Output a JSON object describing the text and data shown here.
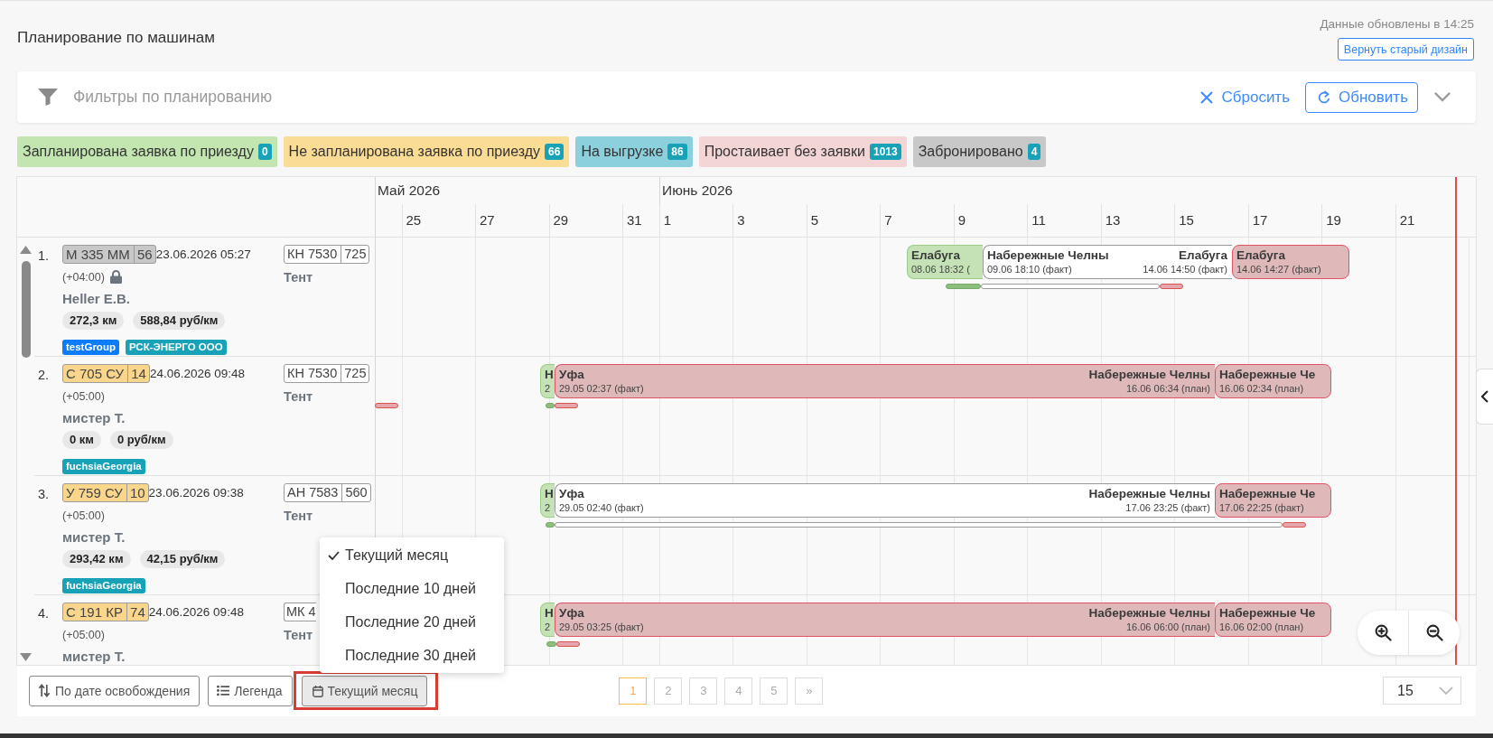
{
  "header": {
    "title": "Планирование по машинам",
    "updated_text": "Данные обновлены в 14:25",
    "old_design_button": "Вернуть старый дизайн"
  },
  "filters": {
    "title": "Фильтры по планированию",
    "reset": "Сбросить",
    "refresh": "Обновить",
    "expanded": false
  },
  "status_chips": [
    {
      "label": "Запланирована заявка по приезду",
      "count": "0",
      "color": "#c3e6b1"
    },
    {
      "label": "Не запланирована заявка по приезду",
      "count": "66",
      "color": "#fbdc95"
    },
    {
      "label": "На выгрузке",
      "count": "86",
      "color": "#8dd0dd"
    },
    {
      "label": "Простаивает без заявки",
      "count": "1013",
      "color": "#f3d5d6"
    },
    {
      "label": "Забронировано",
      "count": "4",
      "color": "#c8c8c8"
    }
  ],
  "timeline": {
    "months": [
      "Май 2026",
      "Июнь 2026"
    ],
    "days": [
      "25",
      "27",
      "29",
      "31",
      "1",
      "3",
      "5",
      "7",
      "9",
      "11",
      "13",
      "15",
      "17",
      "19",
      "21"
    ]
  },
  "vehicles": [
    {
      "number": "1.",
      "plate": {
        "number": "М 335 ММ",
        "region": "56",
        "color": "#c8c8c8"
      },
      "date": "23.06.2026 05:27",
      "timezone": "(+04:00)",
      "locked": true,
      "driver": "Heller E.B.",
      "distance": "272,3 км",
      "rate": "588,84 руб/км",
      "tags": [
        {
          "label": "testGroup",
          "color": "#0b7dfc"
        },
        {
          "label": "РСК-ЭНЕРГО ООО",
          "color": "#17a2b8"
        }
      ],
      "trailer": {
        "number": "КН 7530",
        "region": "725"
      },
      "body": "Тент",
      "trips": [
        {
          "start_label": "Елабуга",
          "start_time": "08.06 18:32 (",
          "color": "#c4e2b5"
        },
        {
          "start_label": "Набережные Челны",
          "start_time": "09.06 18:10 (факт)",
          "end_label": "Елабуга",
          "end_time": "14.06 14:50 (факт)",
          "color": "#ffffff"
        },
        {
          "start_label": "Елабуга",
          "start_time": "14.06 14:27 (факт)",
          "color": "#dfb9ba"
        }
      ],
      "tracks": [
        {
          "color": "#8cbf7c"
        },
        {
          "color": "#ffffff"
        },
        {
          "color": "#e6a6ad"
        }
      ]
    },
    {
      "number": "2.",
      "plate": {
        "number": "С 705 СУ",
        "region": "14",
        "color": "#fad68c"
      },
      "date": "24.06.2026 09:48",
      "timezone": "(+05:00)",
      "locked": false,
      "driver": "мистер Т.",
      "distance": "0 км",
      "rate": "0 руб/км",
      "tags": [
        {
          "label": "fuchsiaGeorgia",
          "color": "#17a2b8"
        }
      ],
      "trailer": {
        "number": "КН 7530",
        "region": "725"
      },
      "body": "Тент",
      "trips": [
        {
          "start_label": "Н",
          "start_time": "2",
          "color": "#c4e2b5"
        },
        {
          "start_label": "Уфа",
          "start_time": "29.05 02:37 (факт)",
          "end_label": "Набережные Челны",
          "end_time": "16.06 06:34 (план)",
          "color": "#dfb9ba"
        },
        {
          "start_label": "Набережные Че",
          "start_time": "16.06 02:34 (план)",
          "color": "#dfb9ba"
        }
      ],
      "tracks": [
        {
          "color": "#e6a6ad"
        },
        {
          "color": "#8cbf7c"
        },
        {
          "color": "#e6a6ad"
        }
      ]
    },
    {
      "number": "3.",
      "plate": {
        "number": "У 759 СУ",
        "region": "10",
        "color": "#fad68c"
      },
      "date": "23.06.2026 09:38",
      "timezone": "(+05:00)",
      "locked": false,
      "driver": "мистер Т.",
      "distance": "293,42 км",
      "rate": "42,15 руб/км",
      "tags": [
        {
          "label": "fuchsiaGeorgia",
          "color": "#17a2b8"
        }
      ],
      "trailer": {
        "number": "АН 7583",
        "region": "560"
      },
      "body": "Тент",
      "trips": [
        {
          "start_label": "Н",
          "start_time": "2",
          "color": "#c4e2b5"
        },
        {
          "start_label": "Уфа",
          "start_time": "29.05 02:40 (факт)",
          "end_label": "Набережные Челны",
          "end_time": "17.06 23:25 (факт)",
          "color": "#ffffff"
        },
        {
          "start_label": "Набережные Че",
          "start_time": "17.06 22:25 (факт)",
          "color": "#dfb9ba"
        }
      ],
      "tracks": [
        {
          "color": "#8cbf7c"
        },
        {
          "color": "#ffffff"
        },
        {
          "color": "#e6a6ad"
        }
      ]
    },
    {
      "number": "4.",
      "plate": {
        "number": "С 191 КР",
        "region": "74",
        "color": "#fad68c"
      },
      "date": "24.06.2026 09:48",
      "timezone": "(+05:00)",
      "locked": false,
      "driver": "мистер Т.",
      "trailer": {
        "number": "МК 4"
      },
      "body": "Тент",
      "trips": [
        {
          "start_label": "Н",
          "start_time": "2",
          "color": "#c4e2b5"
        },
        {
          "start_label": "Уфа",
          "start_time": "29.05 03:25 (факт)",
          "end_label": "Набережные Челны",
          "end_time": "16.06 06:00 (план)",
          "color": "#dfb9ba"
        },
        {
          "start_label": "Набережные Че",
          "start_time": "16.06 02:00 (план)",
          "color": "#dfb9ba"
        }
      ],
      "tracks": [
        {
          "color": "#8cbf7c"
        },
        {
          "color": "#e6a6ad"
        }
      ]
    }
  ],
  "period_menu": {
    "items": [
      {
        "label": "Текущий месяц",
        "selected": true
      },
      {
        "label": "Последние 10 дней",
        "selected": false
      },
      {
        "label": "Последние 20 дней",
        "selected": false
      },
      {
        "label": "Последние 30 дней",
        "selected": false
      }
    ]
  },
  "toolbar": {
    "sort_button": "По дате освобождения",
    "legend_button": "Легенда",
    "period_button": "Текущий месяц"
  },
  "pagination": {
    "pages": [
      {
        "label": "1",
        "selected": true
      },
      {
        "label": "2",
        "selected": false
      },
      {
        "label": "3",
        "selected": false
      },
      {
        "label": "4",
        "selected": false
      },
      {
        "label": "5",
        "selected": false
      }
    ],
    "next": "»"
  },
  "page_size": "15"
}
